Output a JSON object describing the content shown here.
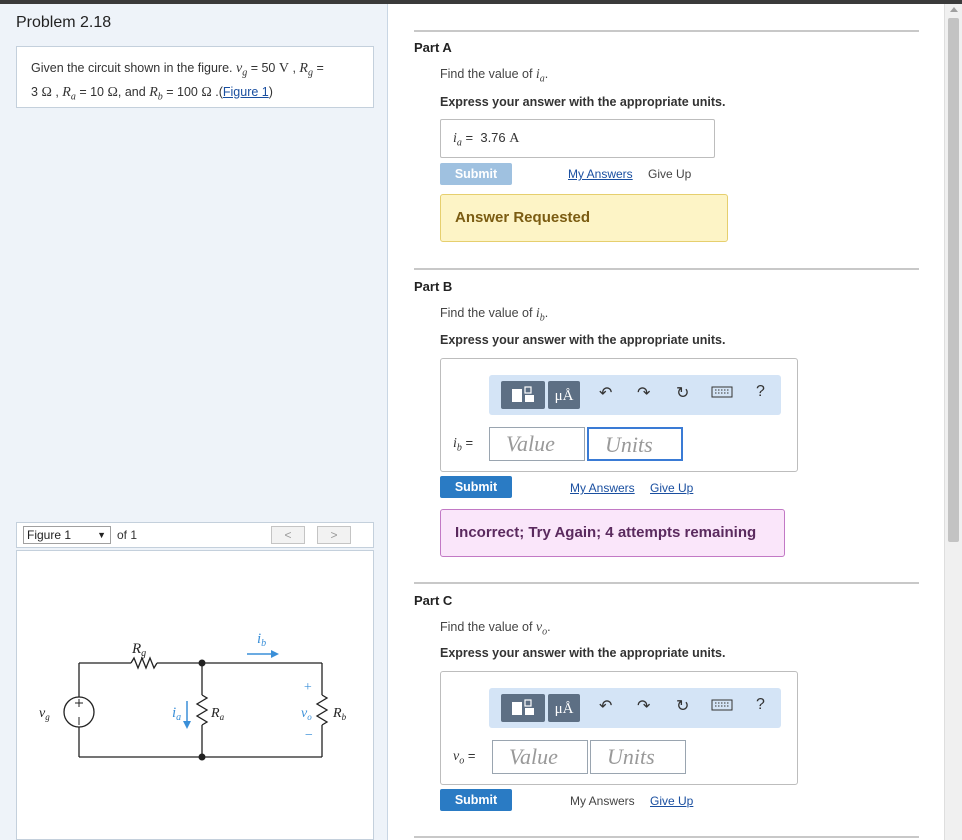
{
  "problem": {
    "title": "Problem 2.18",
    "given_prefix": "Given the circuit shown in the figure.",
    "vg_sym": "v",
    "vg_sub": "g",
    "vg_val": "= 50",
    "vg_unit": "V",
    "rg_sym": "R",
    "rg_sub": "g",
    "rg_val": "=",
    "rg_num": "3",
    "rg_unit": "Ω",
    "ra_sym": "R",
    "ra_sub": "a",
    "ra_val": "= 10",
    "ra_unit": "Ω",
    "and_text": ", and",
    "rb_sym": "R",
    "rb_sub": "b",
    "rb_val": "= 100",
    "rb_unit": "Ω",
    "figure_link": "Figure 1",
    "figure_link_open": " .(",
    "figure_link_close": ")"
  },
  "figure": {
    "selector_value": "Figure 1",
    "of_text": "of 1",
    "prev": "<",
    "next": ">",
    "labels": {
      "Rg": "R",
      "Rg_sub": "g",
      "ib": "i",
      "ib_sub": "b",
      "vg": "v",
      "vg_sub": "g",
      "ia": "i",
      "ia_sub": "a",
      "Ra": "R",
      "Ra_sub": "a",
      "vo": "v",
      "vo_sub": "o",
      "Rb": "R",
      "Rb_sub": "b",
      "plus": "+",
      "minus": "−"
    }
  },
  "parts": {
    "a": {
      "label": "Part A",
      "question_prefix": "Find the value of",
      "sym": "i",
      "sub": "a",
      "period": ".",
      "instruction": "Express your answer with the appropriate units.",
      "answer_eq": "=",
      "answer_value": "3.76",
      "answer_unit": "A",
      "submit": "Submit",
      "my_answers": "My Answers",
      "give_up": "Give Up",
      "feedback": "Answer Requested"
    },
    "b": {
      "label": "Part B",
      "question_prefix": "Find the value of",
      "sym": "i",
      "sub": "b",
      "period": ".",
      "instruction": "Express your answer with the appropriate units.",
      "eq": "=",
      "value_placeholder": "Value",
      "units_placeholder": "Units",
      "submit": "Submit",
      "my_answers": "My Answers",
      "give_up": "Give Up",
      "feedback": "Incorrect; Try Again; 4 attempts remaining"
    },
    "c": {
      "label": "Part C",
      "question_prefix": "Find the value of",
      "sym": "v",
      "sub": "o",
      "period": ".",
      "instruction": "Express your answer with the appropriate units.",
      "eq": "=",
      "value_placeholder": "Value",
      "units_placeholder": "Units",
      "submit": "Submit",
      "my_answers": "My Answers",
      "give_up": "Give Up"
    }
  },
  "toolbar": {
    "units_button": "μÅ",
    "help": "?",
    "icons": [
      "templates-icon",
      "units-icon",
      "undo-icon",
      "redo-icon",
      "reset-icon",
      "keyboard-icon",
      "help-icon"
    ]
  }
}
